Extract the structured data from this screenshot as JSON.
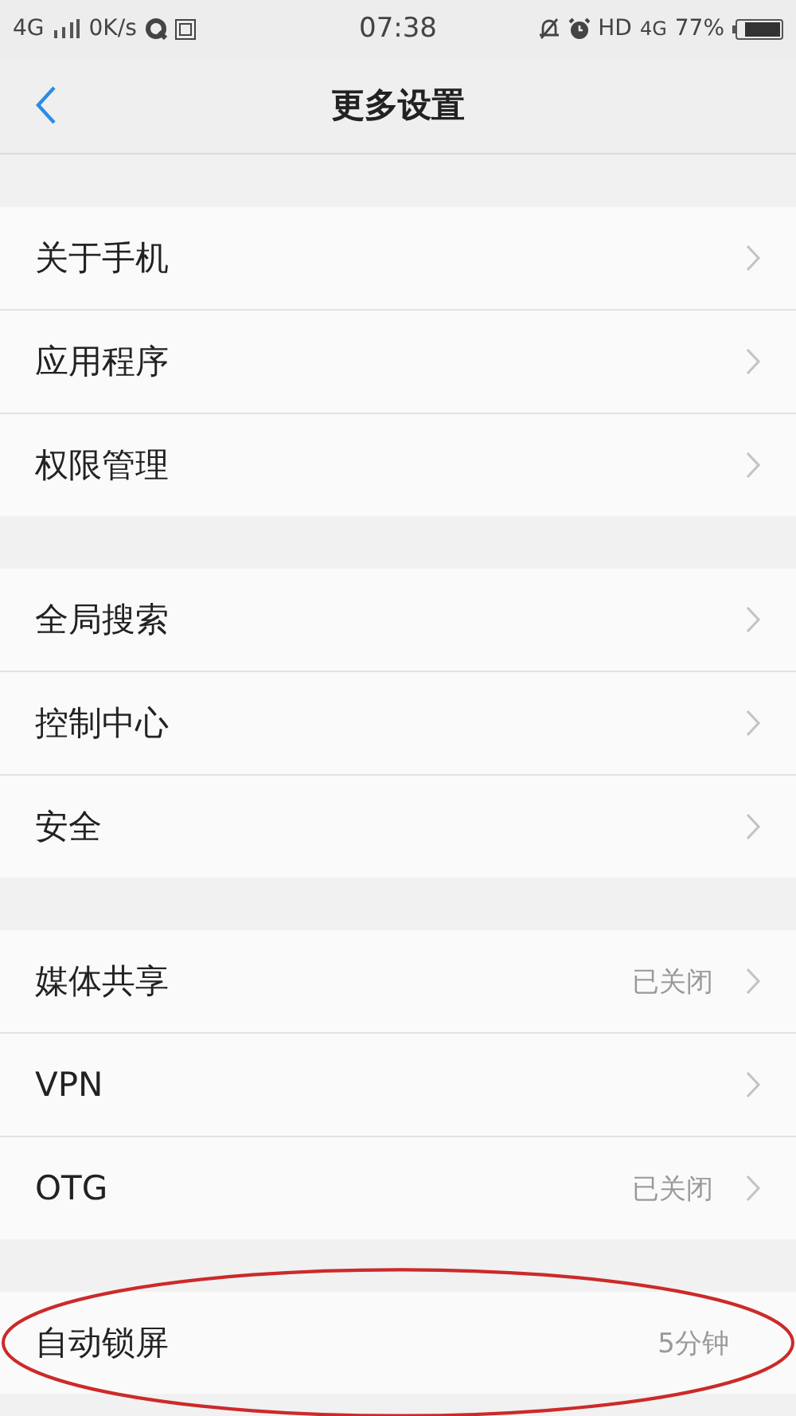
{
  "status_bar": {
    "network": "4G",
    "speed": "0K/s",
    "time": "07:38",
    "hd": "HD",
    "network_right": "4G",
    "battery": "77%"
  },
  "nav": {
    "back": true,
    "title": "更多设置"
  },
  "groups": [
    {
      "items": [
        {
          "label": "关于手机",
          "circled": false
        },
        {
          "label": "应用程序",
          "circled": false
        },
        {
          "label": "权限管理",
          "circled": false
        }
      ]
    },
    {
      "items": [
        {
          "label": "全局搜索",
          "circled": false
        },
        {
          "label": "控制中心",
          "circled": false
        },
        {
          "label": "安全",
          "circled": false
        }
      ]
    },
    {
      "items": [
        {
          "label": "媒体共享",
          "value": "已关闭",
          "circled": false
        },
        {
          "label": "VPN",
          "circled": false
        },
        {
          "label": "OTG",
          "value": "已关闭",
          "circled": false
        }
      ]
    },
    {
      "items": [
        {
          "label": "自动锁屏",
          "value": "5分钟",
          "chevron": false,
          "circled": true
        }
      ]
    }
  ]
}
